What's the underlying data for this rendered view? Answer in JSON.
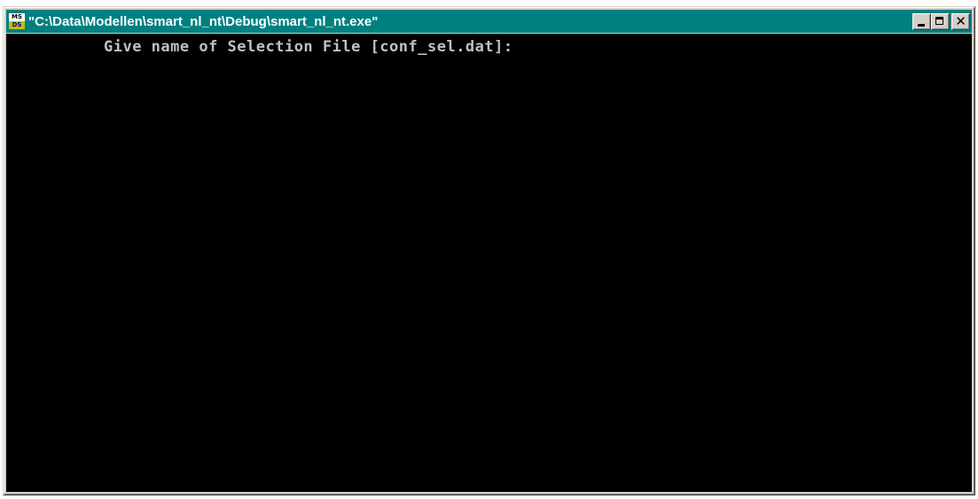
{
  "window": {
    "title": "\"C:\\Data\\Modellen\\smart_nl_nt\\Debug\\smart_nl_nt.exe\"",
    "icon": {
      "name": "msdev-console-icon",
      "top_text": "MS",
      "bottom_text": "DS"
    },
    "buttons": {
      "minimize_icon": "minimize-icon",
      "maximize_icon": "maximize-icon",
      "close_icon": "close-icon",
      "close_glyph": "✕"
    }
  },
  "console": {
    "lines": [
      "Give name of Selection File [conf_sel.dat]:"
    ],
    "colors": {
      "background": "#000000",
      "text": "#c0c0c0"
    }
  },
  "colors": {
    "titlebar": "#008080",
    "chrome": "#d4d0c8"
  }
}
